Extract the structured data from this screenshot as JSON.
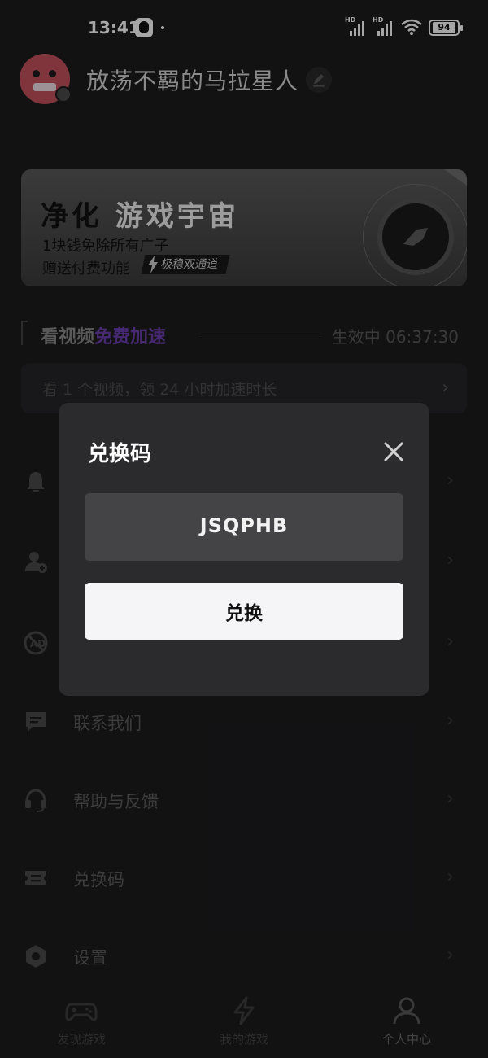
{
  "status_bar": {
    "time": "13:41",
    "signal1_label": "HD",
    "signal2_label": "HD",
    "battery": "94"
  },
  "profile": {
    "username": "放荡不羁的马拉星人"
  },
  "banner": {
    "title_dark": "净化",
    "title_light": "游戏宇宙",
    "line1": "1块钱免除所有广子",
    "line2": "赠送付费功能",
    "badge": "极稳双通道"
  },
  "video": {
    "title_plain": "看视频",
    "title_accent": "免费加速",
    "status": "生效中 06:37:30",
    "tip": "看 1 个视频，领 24 小时加速时长"
  },
  "menu": {
    "items": [
      {
        "label": "",
        "icon": "bell-icon"
      },
      {
        "label": "",
        "icon": "add-user-icon"
      },
      {
        "label": "",
        "icon": "ad-block-icon"
      },
      {
        "label": "联系我们",
        "icon": "chat-icon"
      },
      {
        "label": "帮助与反馈",
        "icon": "headset-icon"
      },
      {
        "label": "兑换码",
        "icon": "ticket-icon"
      },
      {
        "label": "设置",
        "icon": "settings-icon"
      }
    ]
  },
  "tabs": [
    {
      "label": "发现游戏",
      "icon": "gamepad-icon"
    },
    {
      "label": "我的游戏",
      "icon": "lightning-icon"
    },
    {
      "label": "个人中心",
      "icon": "person-icon",
      "active": true
    }
  ],
  "modal": {
    "title": "兑换码",
    "code": "JSQPHB",
    "button": "兑换"
  },
  "colors": {
    "background": "#1c1c1e",
    "modal_bg": "#2b2b2d",
    "code_box": "#444446",
    "accent_purple": "#6c3fb0",
    "button_bg": "#f5f5f7"
  }
}
